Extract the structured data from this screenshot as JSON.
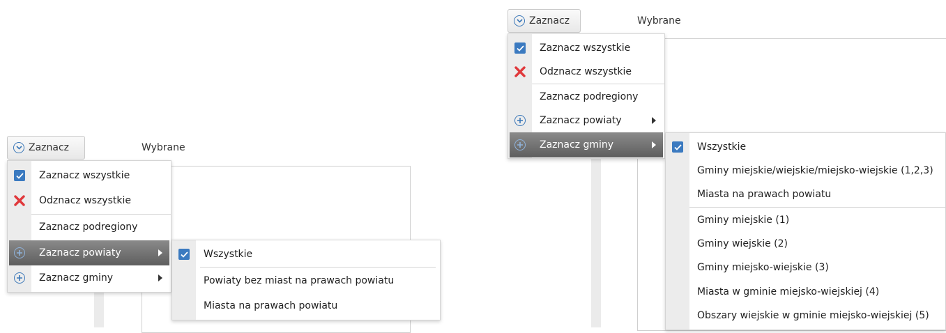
{
  "left": {
    "button_label": "Zaznacz",
    "header_label": "Wybrane",
    "menu": {
      "select_all": "Zaznacz wszystkie",
      "deselect_all": "Odznacz wszystkie",
      "select_subregions": "Zaznacz podregiony",
      "select_counties": "Zaznacz powiaty",
      "select_communes": "Zaznacz gminy"
    },
    "submenu": {
      "all": "Wszystkie",
      "counties_without_cities": "Powiaty bez miast na prawach powiatu",
      "cities_with_county_rights": "Miasta na prawach powiatu"
    }
  },
  "right": {
    "button_label": "Zaznacz",
    "header_label": "Wybrane",
    "menu": {
      "select_all": "Zaznacz wszystkie",
      "deselect_all": "Odznacz wszystkie",
      "select_subregions": "Zaznacz podregiony",
      "select_counties": "Zaznacz powiaty",
      "select_communes": "Zaznacz gminy"
    },
    "submenu": {
      "all": "Wszystkie",
      "urban_rural_mixed": "Gminy miejskie/wiejskie/miejsko-wiejskie (1,2,3)",
      "cities_with_county_rights": "Miasta na prawach powiatu",
      "urban": "Gminy miejskie (1)",
      "rural": "Gminy wiejskie (2)",
      "urban_rural": "Gminy miejsko-wiejskie (3)",
      "towns_in_urban_rural": "Miasta w gminie miejsko-wiejskiej (4)",
      "rural_areas_in_urban_rural": "Obszary wiejskie w gminie miejsko-wiejskiej (5)"
    }
  },
  "colors": {
    "accent": "#3b7ac0",
    "close": "#e0383b",
    "highlight": "#6e6e6e"
  }
}
